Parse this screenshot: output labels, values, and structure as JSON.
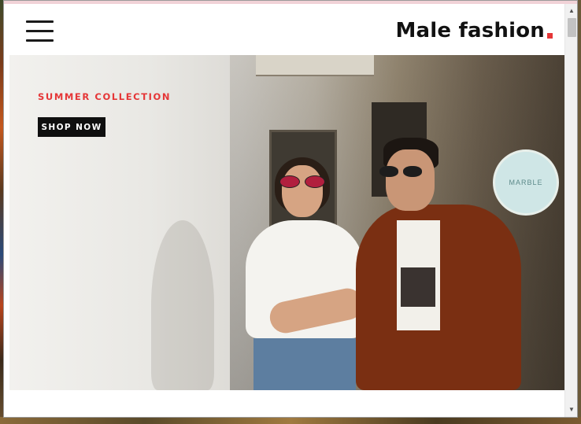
{
  "header": {
    "logo_text": "Male fashion",
    "logo_dot_color": "#e53637"
  },
  "menu": {
    "icon": "hamburger-menu-icon"
  },
  "hero": {
    "subtitle": "SUMMER COLLECTION",
    "button_label": "SHOP NOW",
    "accent_color": "#e53637"
  },
  "background_photo": {
    "shop_sign_text": "MARBLE"
  },
  "scrollbar": {
    "up_icon": "▲",
    "down_icon": "▼"
  }
}
